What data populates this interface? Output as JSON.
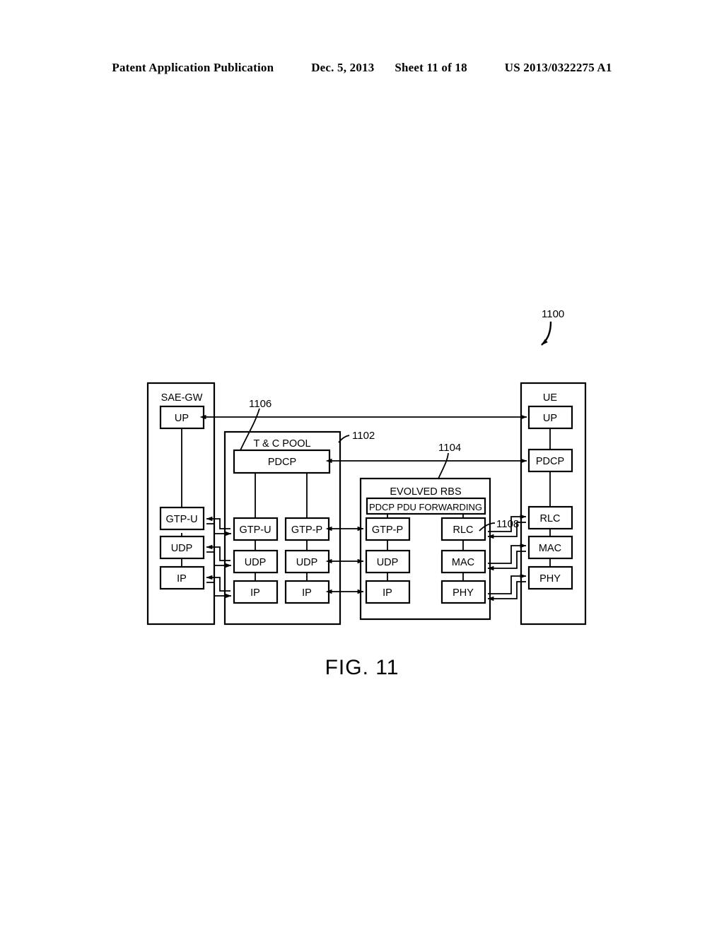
{
  "header": {
    "publication": "Patent Application Publication",
    "date": "Dec. 5, 2013",
    "sheet": "Sheet 11 of 18",
    "number": "US 2013/0322275 A1"
  },
  "figure": {
    "caption": "FIG. 11",
    "diagram_ref": "1100",
    "refs": [
      {
        "id": "ref-1102",
        "label": "1102",
        "points_to": "t-c-pool-container"
      },
      {
        "id": "ref-1104",
        "label": "1104",
        "points_to": "evolved-rbs-container"
      },
      {
        "id": "ref-1106",
        "label": "1106",
        "points_to": "tc-pool-pdcp-box"
      },
      {
        "id": "ref-1108",
        "label": "1108",
        "points_to": "evolved-rbs-rlc-box"
      }
    ],
    "nodes": {
      "sae_gw": {
        "title": "SAE-GW",
        "stack": [
          "UP",
          "GTP-U",
          "UDP",
          "IP"
        ]
      },
      "tc_pool": {
        "title": "T & C POOL",
        "pdcp": "PDCP",
        "left_stack": [
          "GTP-U",
          "UDP",
          "IP"
        ],
        "right_stack": [
          "GTP-P",
          "UDP",
          "IP"
        ]
      },
      "evolved_rbs": {
        "title": "EVOLVED RBS",
        "banner": "PDCP PDU FORWARDING",
        "left_stack": [
          "GTP-P",
          "UDP",
          "IP"
        ],
        "right_stack": [
          "RLC",
          "MAC",
          "PHY"
        ]
      },
      "ue": {
        "title": "UE",
        "stack": [
          "UP",
          "PDCP",
          "RLC",
          "MAC",
          "PHY"
        ]
      }
    }
  },
  "colors": {
    "ink": "#000000",
    "paper": "#ffffff"
  }
}
